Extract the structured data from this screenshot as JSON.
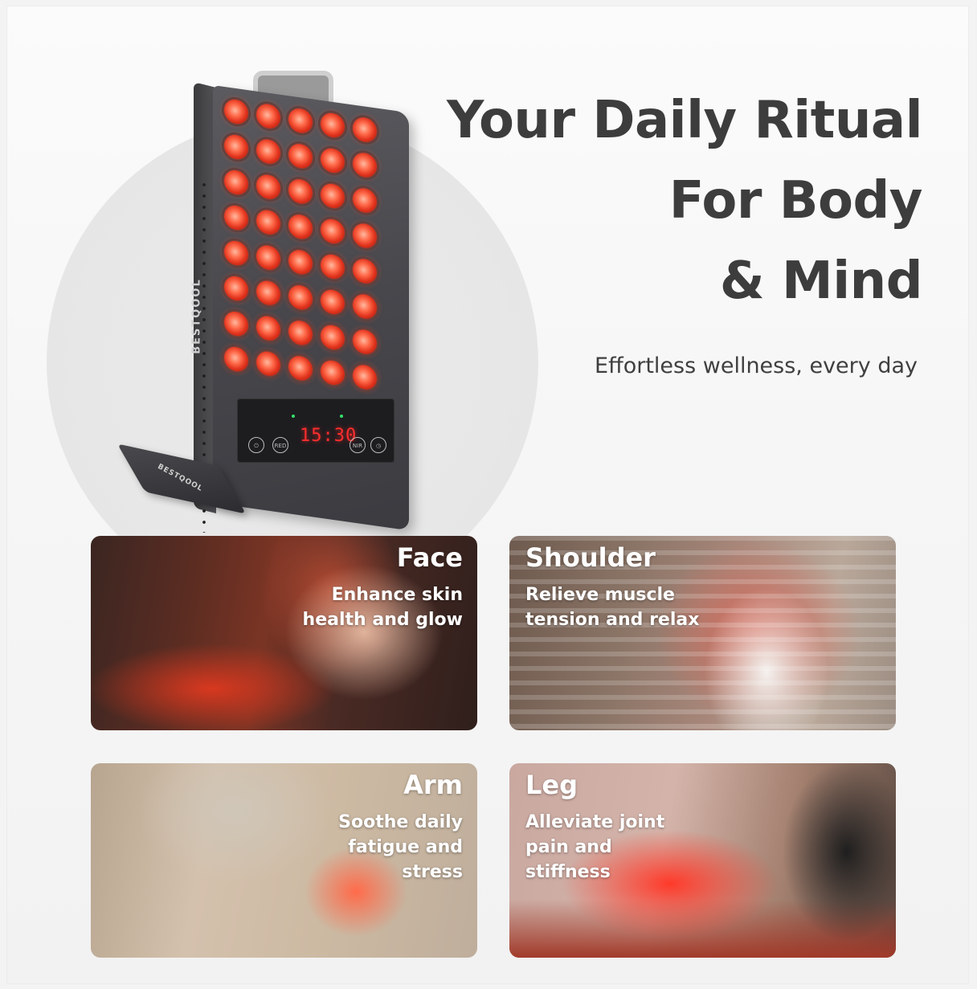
{
  "headline": {
    "line1": "Your Daily Ritual",
    "line2": "For Body",
    "line3": "& Mind"
  },
  "subhead": "Effortless wellness, every day",
  "device": {
    "brand_side": "BESTQOOL",
    "brand_stand": "BESTQOOL",
    "timer": "15:30",
    "buttons": [
      "power",
      "RED",
      "NIR",
      "timer"
    ],
    "button_labels": {
      "red": "RED",
      "nir": "NIR"
    },
    "led_count": 40,
    "led_color": "#ff5a3a"
  },
  "cards": [
    {
      "title": "Face",
      "text": "Enhance skin health and glow"
    },
    {
      "title": "Shoulder",
      "text": "Relieve muscle tension and relax"
    },
    {
      "title": "Arm",
      "text": "Soothe daily fatigue and stress"
    },
    {
      "title": "Leg",
      "text": "Alleviate joint pain and stiffness"
    }
  ],
  "colors": {
    "headline": "#3d3d3d",
    "card_text": "#ffffff",
    "accent_red": "#e0321c"
  }
}
